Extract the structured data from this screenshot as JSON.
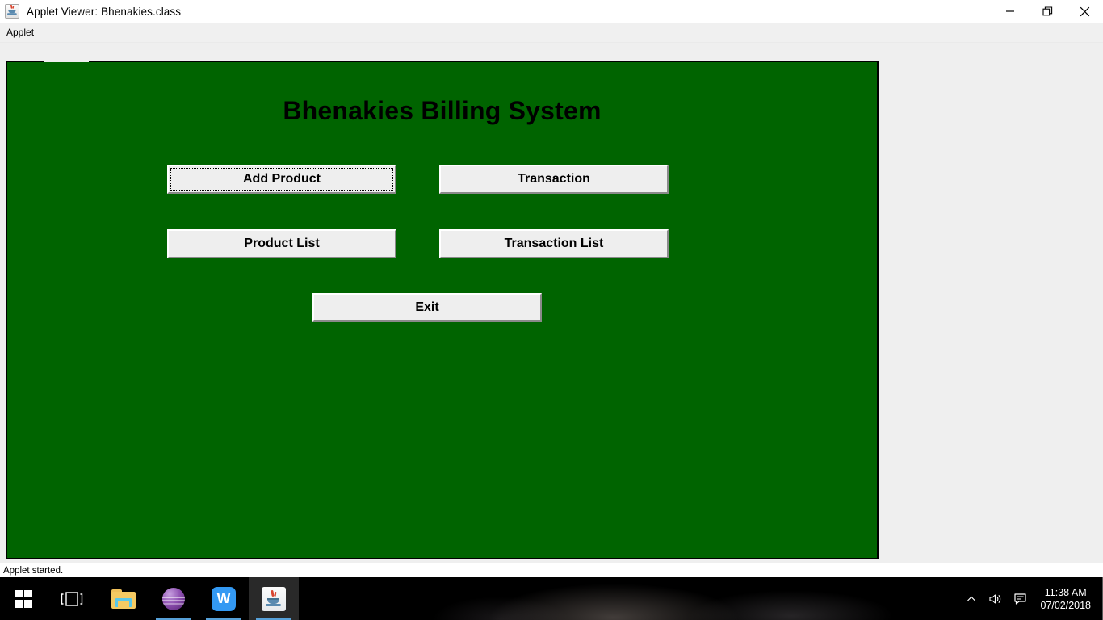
{
  "window": {
    "title": "Applet Viewer: Bhenakies.class",
    "icon": "java-icon",
    "controls": {
      "minimize": "minimize-icon",
      "restore": "restore-icon",
      "close": "close-icon"
    }
  },
  "menu": {
    "items": [
      {
        "label": "Applet"
      }
    ]
  },
  "applet": {
    "background_color": "#006400",
    "title": "Bhenakies Billing System",
    "buttons": [
      {
        "id": "add-product",
        "label": "Add Product",
        "focused": true
      },
      {
        "id": "transaction",
        "label": "Transaction",
        "focused": false
      },
      {
        "id": "product-list",
        "label": "Product List",
        "focused": false
      },
      {
        "id": "transaction-list",
        "label": "Transaction List",
        "focused": false
      },
      {
        "id": "exit",
        "label": "Exit",
        "focused": false
      }
    ]
  },
  "status": {
    "text": "Applet started."
  },
  "taskbar": {
    "start": "windows-logo-icon",
    "task_view": "task-view-icon",
    "apps": [
      {
        "id": "explorer",
        "name": "file-explorer-icon",
        "active": false
      },
      {
        "id": "eclipse",
        "name": "eclipse-icon",
        "active": true
      },
      {
        "id": "wps",
        "name": "wps-writer-icon",
        "active": true,
        "label": "W"
      },
      {
        "id": "java",
        "name": "java-applet-icon",
        "active": true
      }
    ],
    "tray": {
      "show_hidden": "chevron-up-icon",
      "volume": "speaker-icon",
      "action_center": "notification-icon"
    },
    "clock": {
      "time": "11:38 AM",
      "date": "07/02/2018"
    }
  }
}
